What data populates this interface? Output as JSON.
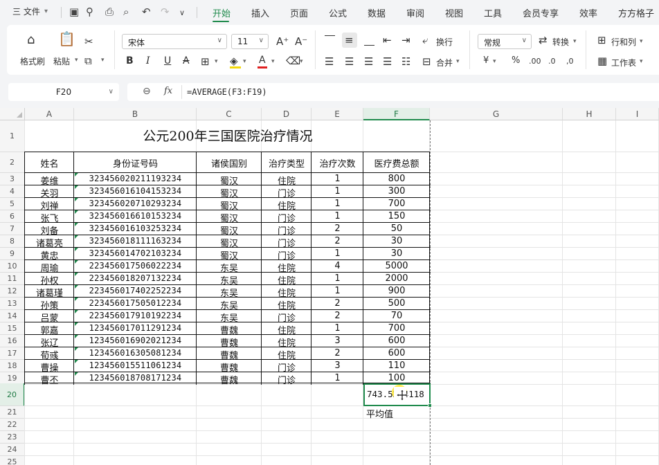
{
  "menubar": {
    "file_menu": "三 文件",
    "tabs": [
      "开始",
      "插入",
      "页面",
      "公式",
      "数据",
      "审阅",
      "视图",
      "工具",
      "会员专享",
      "效率",
      "方方格子"
    ],
    "active_tab": "开始"
  },
  "ribbon": {
    "format_painter": "格式刷",
    "paste": "粘贴",
    "font_name": "宋体",
    "font_size": "11",
    "number_format": "常规",
    "convert": "转换",
    "row_col": "行和列",
    "wrap": "换行",
    "merge": "合并",
    "worksheet": "工作表",
    "currency_symbol": "¥",
    "percent_symbol": "%"
  },
  "formula_bar": {
    "cell_ref": "F20",
    "fx": "fx",
    "formula": "=AVERAGE(F3:F19)"
  },
  "sheet": {
    "columns": [
      "A",
      "B",
      "C",
      "D",
      "E",
      "F",
      "G",
      "H",
      "I"
    ],
    "rows": [
      "1",
      "2",
      "3",
      "4",
      "5",
      "6",
      "7",
      "8",
      "9",
      "10",
      "11",
      "12",
      "13",
      "14",
      "15",
      "16",
      "17",
      "18",
      "19",
      "20",
      "21",
      "22",
      "23",
      "24",
      "25"
    ],
    "title": "公元200年三国医院治疗情况",
    "headers": [
      "姓名",
      "身份证号码",
      "诸侯国别",
      "治疗类型",
      "治疗次数",
      "医疗费总额"
    ],
    "records": [
      [
        "姜维",
        "323456020211193234",
        "蜀汉",
        "住院",
        "1",
        "800"
      ],
      [
        "关羽",
        "323456016104153234",
        "蜀汉",
        "门诊",
        "1",
        "300"
      ],
      [
        "刘禅",
        "323456020710293234",
        "蜀汉",
        "住院",
        "1",
        "700"
      ],
      [
        "张飞",
        "323456016610153234",
        "蜀汉",
        "门诊",
        "1",
        "150"
      ],
      [
        "刘备",
        "323456016103253234",
        "蜀汉",
        "门诊",
        "2",
        "50"
      ],
      [
        "诸葛亮",
        "323456018111163234",
        "蜀汉",
        "门诊",
        "2",
        "30"
      ],
      [
        "黄忠",
        "323456014702103234",
        "蜀汉",
        "门诊",
        "1",
        "30"
      ],
      [
        "周瑜",
        "223456017506022234",
        "东吴",
        "住院",
        "4",
        "5000"
      ],
      [
        "孙权",
        "223456018207132234",
        "东吴",
        "住院",
        "1",
        "2000"
      ],
      [
        "诸葛瑾",
        "223456017402252234",
        "东吴",
        "住院",
        "1",
        "900"
      ],
      [
        "孙策",
        "223456017505012234",
        "东吴",
        "住院",
        "2",
        "500"
      ],
      [
        "吕蒙",
        "223456017910192234",
        "东吴",
        "门诊",
        "2",
        "70"
      ],
      [
        "郭嘉",
        "123456017011291234",
        "曹魏",
        "住院",
        "1",
        "700"
      ],
      [
        "张辽",
        "123456016902021234",
        "曹魏",
        "住院",
        "3",
        "600"
      ],
      [
        "荀彧",
        "123456016305081234",
        "曹魏",
        "住院",
        "2",
        "600"
      ],
      [
        "曹操",
        "123456015511061234",
        "曹魏",
        "门诊",
        "3",
        "110"
      ],
      [
        "曹丕",
        "123456018708171234",
        "曹魏",
        "门诊",
        "1",
        "100"
      ]
    ],
    "f20_value": "743.5294118",
    "f21_label": "平均值",
    "selected_cell": "F20"
  },
  "colors": {
    "accent": "#1f8a4c",
    "highlight": "#ffe828"
  }
}
